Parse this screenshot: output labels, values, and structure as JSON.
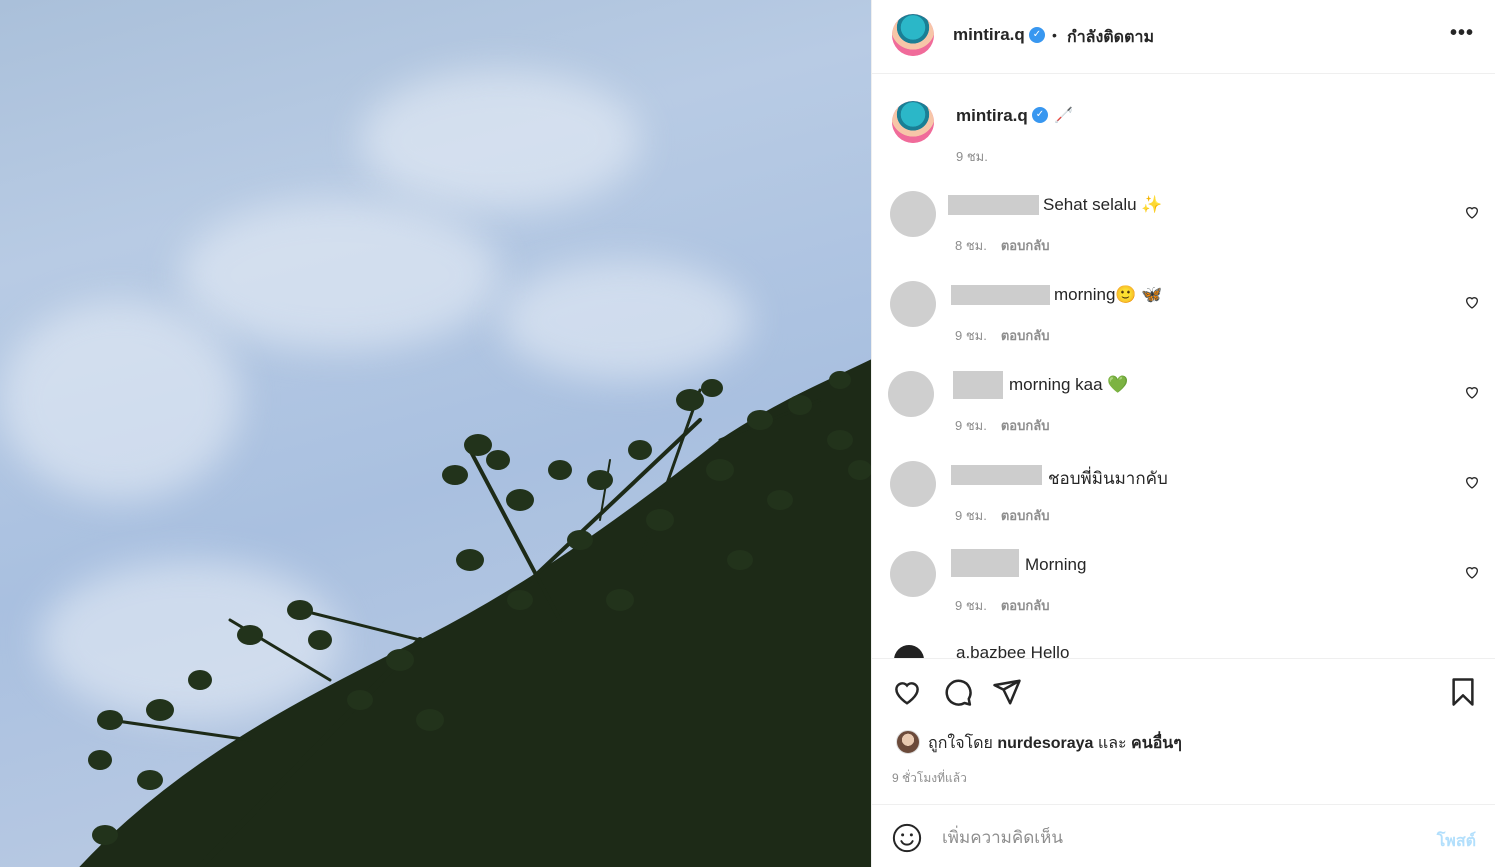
{
  "header": {
    "username": "mintira.q",
    "verified_mark": "✓",
    "separator": "•",
    "follow_status": "กำลังติดตาม",
    "more_label": "•••"
  },
  "caption": {
    "username": "mintira.q",
    "verified_mark": "✓",
    "emoji": "🦯",
    "time": "9 ชม."
  },
  "comments": [
    {
      "text": "Sehat selalu ✨",
      "time": "8 ชม.",
      "reply": "ตอบกลับ"
    },
    {
      "text": "morning🙂 🦋",
      "time": "9 ชม.",
      "reply": "ตอบกลับ"
    },
    {
      "text": "morning kaa 💚",
      "time": "9 ชม.",
      "reply": "ตอบกลับ"
    },
    {
      "text": "ชอบพี่มินมากคับ",
      "time": "9 ชม.",
      "reply": "ตอบกลับ"
    },
    {
      "text": "Morning",
      "time": "9 ชม.",
      "reply": "ตอบกลับ"
    }
  ],
  "partial_comment": {
    "text": "a.bazbee Hello"
  },
  "likes": {
    "prefix": "ถูกใจโดย",
    "user": "nurdesoraya",
    "joiner": "และ",
    "others": "คนอื่นๆ"
  },
  "time_ago": "9 ชั่วโมงที่แล้ว",
  "composer": {
    "placeholder": "เพิ่มความคิดเห็น",
    "post_label": "โพสต์"
  },
  "colors": {
    "verified": "#3897f0",
    "post_disabled": "#b2dffc",
    "muted": "#8e8e8e",
    "text": "#262626"
  },
  "icons": [
    "heart-icon",
    "comment-icon",
    "share-icon",
    "bookmark-icon",
    "emoji-icon",
    "more-icon",
    "verified-icon"
  ]
}
